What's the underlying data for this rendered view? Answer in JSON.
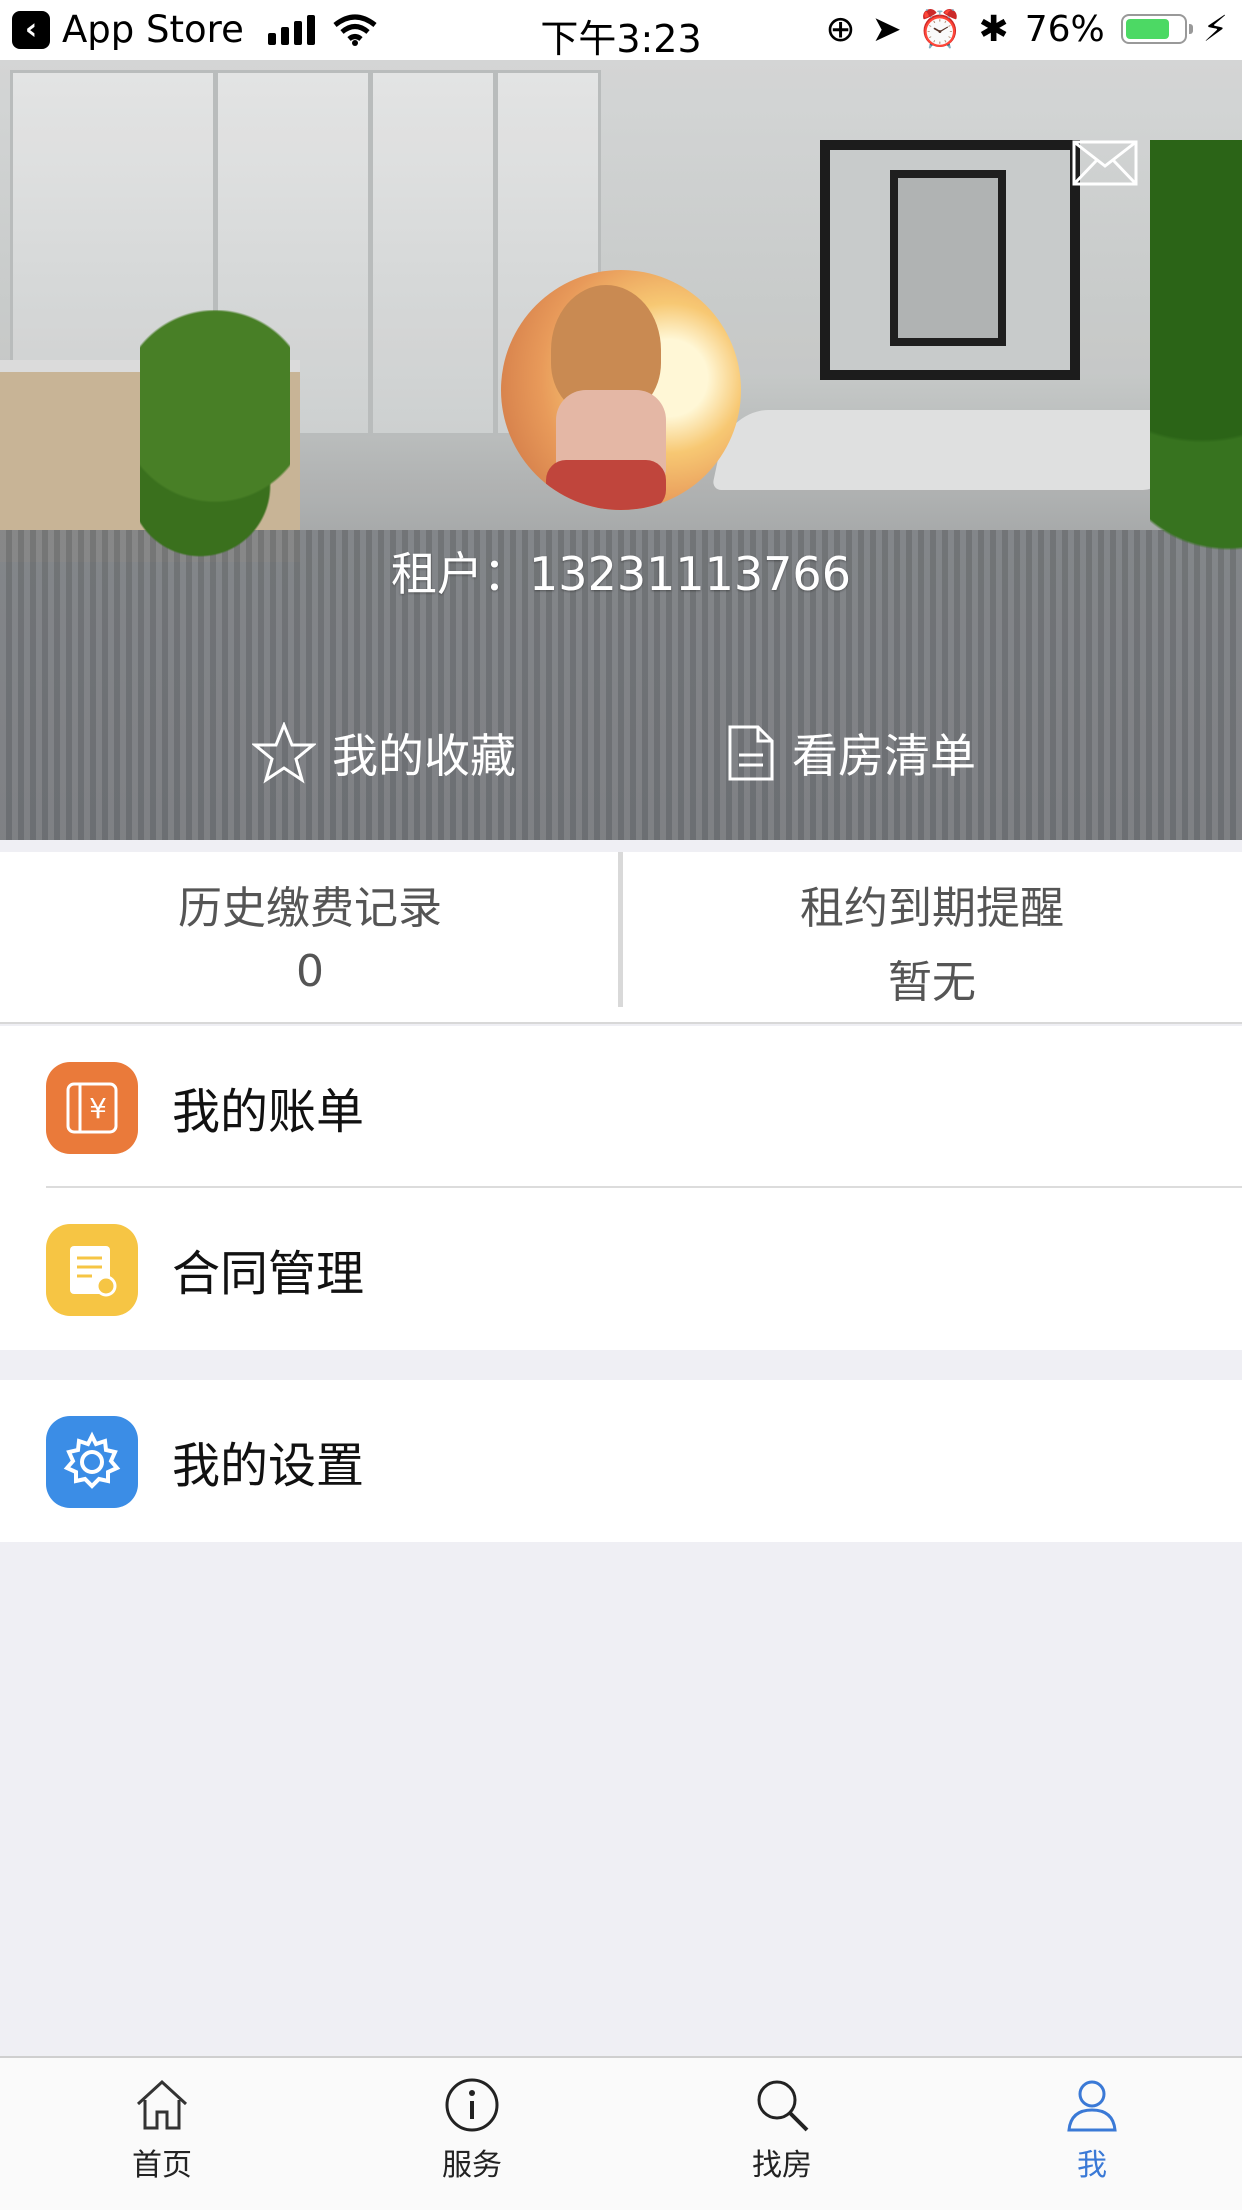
{
  "status_bar": {
    "back_app": "App Store",
    "time": "下午3:23",
    "battery": "76%",
    "battery_level": 0.76
  },
  "header": {
    "tenant_label": "租户：",
    "tenant_phone": "13231113766",
    "favorites": "我的收藏",
    "viewing_list": "看房清单"
  },
  "stats": [
    {
      "title": "历史缴费记录",
      "value": "0"
    },
    {
      "title": "租约到期提醒",
      "value": "暂无"
    }
  ],
  "menu": {
    "bills": {
      "label": "我的账单",
      "icon": "bill-icon",
      "color": "#ea7a3a"
    },
    "contracts": {
      "label": "合同管理",
      "icon": "contract-icon",
      "color": "#f6c544"
    },
    "settings": {
      "label": "我的设置",
      "icon": "gear-icon",
      "color": "#3b8de6"
    }
  },
  "tabbar": {
    "items": [
      {
        "label": "首页",
        "icon": "home-icon"
      },
      {
        "label": "服务",
        "icon": "info-icon"
      },
      {
        "label": "找房",
        "icon": "search-icon"
      },
      {
        "label": "我",
        "icon": "user-icon",
        "active": true
      }
    ],
    "active_color": "#3a79d6"
  }
}
